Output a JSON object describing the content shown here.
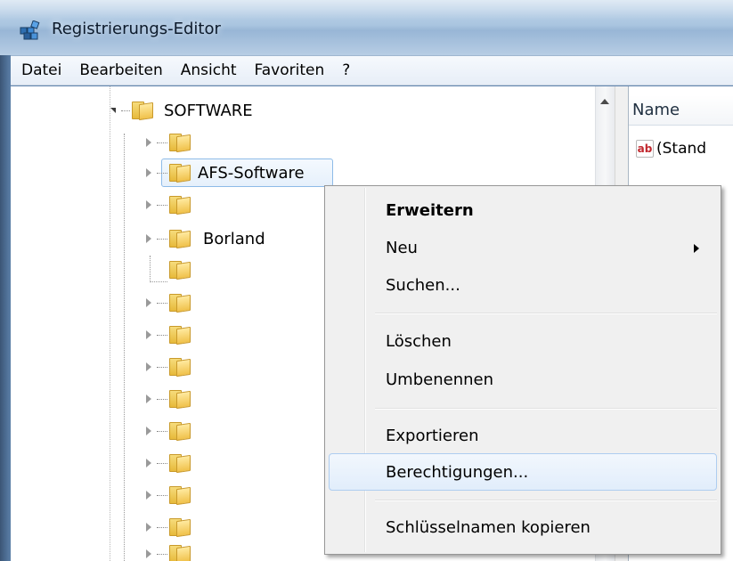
{
  "window": {
    "title": "Registrierungs-Editor",
    "icon": "registry-editor-icon"
  },
  "menu_bar": {
    "items": [
      "Datei",
      "Bearbeiten",
      "Ansicht",
      "Favoriten",
      "?"
    ]
  },
  "tree": {
    "root": {
      "label": "SOFTWARE",
      "expanded": true
    },
    "children": [
      {
        "label": "",
        "expander": "closed"
      },
      {
        "label": "AFS-Software",
        "expander": "closed",
        "selected": true
      },
      {
        "label": "",
        "expander": "closed"
      },
      {
        "label": "Borland",
        "expander": "closed"
      },
      {
        "label": "",
        "expander": "none"
      },
      {
        "label": "",
        "expander": "closed"
      },
      {
        "label": "",
        "expander": "closed"
      },
      {
        "label": "",
        "expander": "closed"
      },
      {
        "label": "",
        "expander": "closed"
      },
      {
        "label": "",
        "expander": "closed"
      },
      {
        "label": "",
        "expander": "closed"
      },
      {
        "label": "",
        "expander": "closed"
      },
      {
        "label": "",
        "expander": "closed"
      },
      {
        "label": "",
        "expander": "closed"
      }
    ]
  },
  "list_pane": {
    "column_name": "Name",
    "rows": [
      {
        "icon": "ab-string-icon",
        "icon_text": "ab",
        "text": "(Stand"
      }
    ]
  },
  "context_menu": {
    "items": [
      {
        "label": "Erweitern",
        "bold": true
      },
      {
        "label": "Neu",
        "submenu": true
      },
      {
        "label": "Suchen..."
      },
      {
        "separator": true
      },
      {
        "label": "Löschen"
      },
      {
        "label": "Umbenennen"
      },
      {
        "separator": true
      },
      {
        "label": "Exportieren"
      },
      {
        "label": "Berechtigungen...",
        "hovered": true
      },
      {
        "separator": true
      },
      {
        "label": "Schlüsselnamen kopieren"
      }
    ]
  },
  "colors": {
    "selection_border": "#8ebbe8",
    "hover_border": "#aecdf0",
    "folder": "#f0c14a"
  }
}
